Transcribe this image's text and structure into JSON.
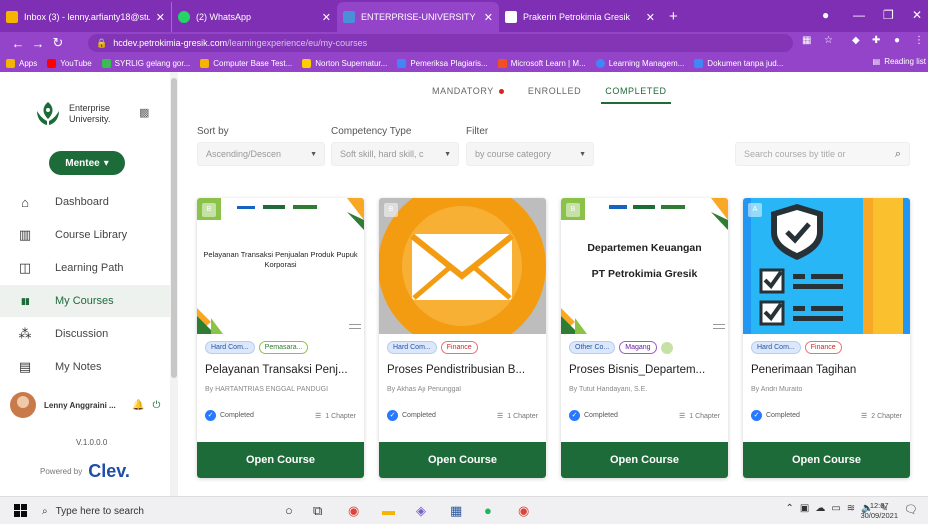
{
  "browser": {
    "tabs": [
      {
        "label": "Inbox (3) - lenny.arfianty18@stu...",
        "fav_color": "#f4b400"
      },
      {
        "label": "(2) WhatsApp",
        "fav_color": "#25d366"
      },
      {
        "label": "ENTERPRISE-UNIVERSITY",
        "fav_color": "#4a90d9"
      },
      {
        "label": "Prakerin Petrokimia Gresik",
        "fav_color": "#ffffff"
      }
    ],
    "new_tab": "+",
    "url_host": "hcdev.petrokimia-gresik.com",
    "url_path": "/learningexperience/eu/my-courses",
    "bookmarks": [
      {
        "label": "Apps",
        "color": "#f4b400"
      },
      {
        "label": "YouTube",
        "color": "#ff0000"
      },
      {
        "label": "SYRLIG gelang gor...",
        "color": "#3cba54"
      },
      {
        "label": "Computer Base Test...",
        "color": "#f4b400"
      },
      {
        "label": "Norton Supernatur...",
        "color": "#ffcc00"
      },
      {
        "label": "Pemeriksa Plagiaris...",
        "color": "#4285f4"
      },
      {
        "label": "Microsoft Learn | M...",
        "color": "#f25022"
      },
      {
        "label": "Learning Managem...",
        "color": "#4285f4"
      },
      {
        "label": "Dokumen tanpa jud...",
        "color": "#4285f4"
      }
    ],
    "reading_list": "Reading list"
  },
  "sidebar": {
    "brand_line1": "Enterprise",
    "brand_line2": "University.",
    "role_button": "Mentee",
    "nav": [
      {
        "label": "Dashboard",
        "icon": "home-icon",
        "glyph": "⌂"
      },
      {
        "label": "Course Library",
        "icon": "library-icon",
        "glyph": "▥"
      },
      {
        "label": "Learning Path",
        "icon": "map-icon",
        "glyph": "◫"
      },
      {
        "label": "My Courses",
        "icon": "book-icon",
        "glyph": "▮▮"
      },
      {
        "label": "Discussion",
        "icon": "people-icon",
        "glyph": "⁂"
      },
      {
        "label": "My Notes",
        "icon": "clipboard-icon",
        "glyph": "▤"
      }
    ],
    "active_index": 3,
    "user_name": "Lenny Anggraini ...",
    "version": "V.1.0.0.0",
    "powered_by": "Powered by",
    "powered_brand": "Clev."
  },
  "main": {
    "tabs": [
      {
        "label": "MANDATORY",
        "dot": true
      },
      {
        "label": "ENROLLED",
        "dot": false
      },
      {
        "label": "COMPLETED",
        "dot": false
      }
    ],
    "active_tab": 2,
    "filters": {
      "sort_label": "Sort by",
      "sort_value": "Ascending/Descen",
      "competency_label": "Competency Type",
      "competency_value": "Soft skill, hard skill, c",
      "filter_label": "Filter",
      "filter_value": "by course category",
      "search_placeholder": "Search courses by title or"
    },
    "courses": [
      {
        "thumb_text": "Pelayanan Transaksi Penjualan Produk Pupuk Korporasi",
        "tags": [
          {
            "label": "Hard Com...",
            "style": "blue"
          },
          {
            "label": "Pemasara...",
            "style": "green"
          }
        ],
        "title": "Pelayanan Transaksi Penj...",
        "author": "By HARTANTRIAS ENGGAL PANDUGI",
        "status": "Completed",
        "chapters": "1 Chapter",
        "button": "Open Course"
      },
      {
        "thumb_text": "",
        "tags": [
          {
            "label": "Hard Com...",
            "style": "blue"
          },
          {
            "label": "Finance",
            "style": "red"
          }
        ],
        "title": "Proses Pendistribusian B...",
        "author": "By Akhas Aji Penunggal",
        "status": "Completed",
        "chapters": "1 Chapter",
        "button": "Open Course"
      },
      {
        "thumb_text_1": "Departemen Keuangan",
        "thumb_text_2": "PT Petrokimia Gresik",
        "tags": [
          {
            "label": "Other Co...",
            "style": "blue"
          },
          {
            "label": "Magang",
            "style": "purple"
          }
        ],
        "title": "Proses Bisnis_Departem...",
        "author": "By Tutut Handayani, S.E.",
        "status": "Completed",
        "chapters": "1 Chapter",
        "button": "Open Course"
      },
      {
        "thumb_text": "",
        "tags": [
          {
            "label": "Hard Com...",
            "style": "blue"
          },
          {
            "label": "Finance",
            "style": "red"
          }
        ],
        "title": "Penerimaan Tagihan",
        "author": "By Andri Muraito",
        "status": "Completed",
        "chapters": "2 Chapter",
        "button": "Open Course"
      }
    ]
  },
  "taskbar": {
    "search_placeholder": "Type here to search",
    "time": "12:37",
    "date": "30/09/2021"
  },
  "colors": {
    "chrome_purple": "#7e2fb3",
    "brand_green": "#1e6b3a",
    "completed_blue": "#2979ff"
  }
}
